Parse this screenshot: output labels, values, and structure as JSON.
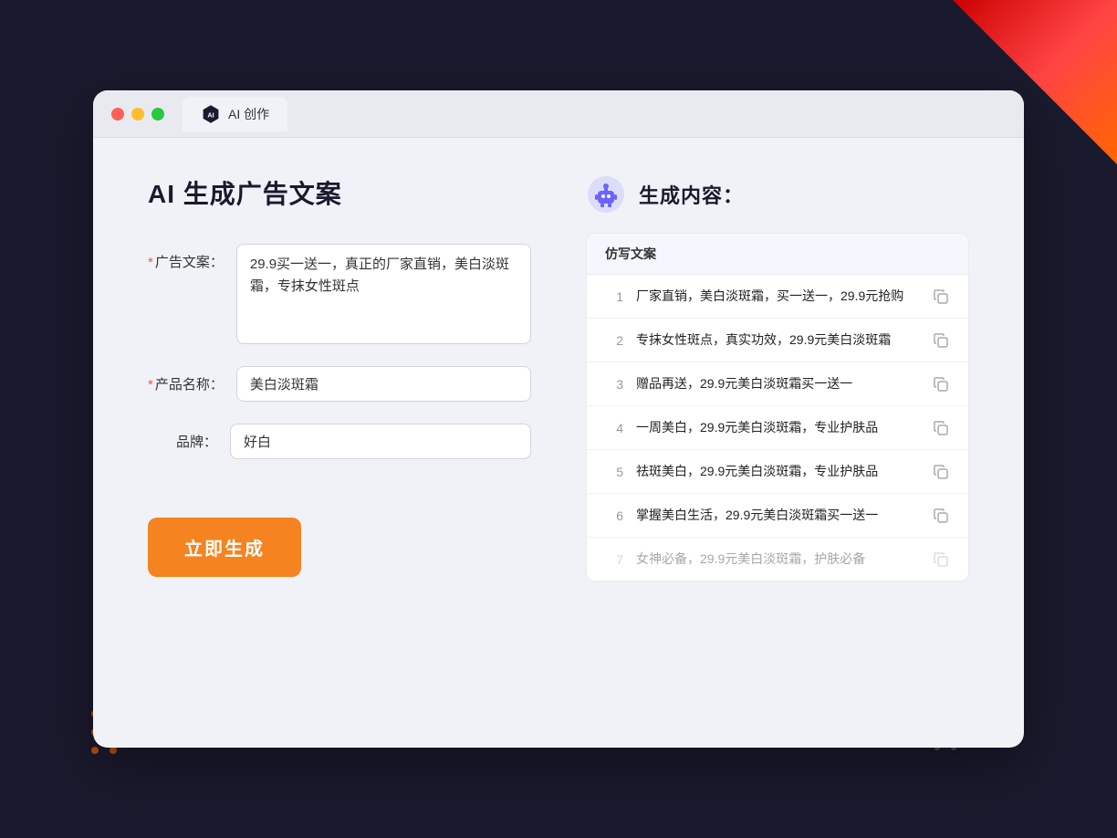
{
  "window": {
    "tab_title": "AI 创作"
  },
  "left": {
    "page_title": "AI 生成广告文案",
    "fields": [
      {
        "label": "广告文案：",
        "required": true,
        "type": "textarea",
        "value": "29.9买一送一，真正的厂家直销，美白淡斑霜，专抹女性斑点",
        "name": "ad-copy-input"
      },
      {
        "label": "产品名称：",
        "required": true,
        "type": "text",
        "value": "美白淡斑霜",
        "name": "product-name-input"
      },
      {
        "label": "品牌：",
        "required": false,
        "type": "text",
        "value": "好白",
        "name": "brand-input"
      }
    ],
    "button_label": "立即生成"
  },
  "right": {
    "title": "生成内容：",
    "column_header": "仿写文案",
    "results": [
      {
        "num": "1",
        "text": "厂家直销，美白淡斑霜，买一送一，29.9元抢购",
        "faded": false
      },
      {
        "num": "2",
        "text": "专抹女性斑点，真实功效，29.9元美白淡斑霜",
        "faded": false
      },
      {
        "num": "3",
        "text": "赠品再送，29.9元美白淡斑霜买一送一",
        "faded": false
      },
      {
        "num": "4",
        "text": "一周美白，29.9元美白淡斑霜，专业护肤品",
        "faded": false
      },
      {
        "num": "5",
        "text": "祛斑美白，29.9元美白淡斑霜，专业护肤品",
        "faded": false
      },
      {
        "num": "6",
        "text": "掌握美白生活，29.9元美白淡斑霜买一送一",
        "faded": false
      },
      {
        "num": "7",
        "text": "女神必备，29.9元美白淡斑霜，护肤必备",
        "faded": true
      }
    ]
  },
  "colors": {
    "orange_btn": "#f5831f",
    "accent_blue": "#5b7cff",
    "required_red": "#ff4d4f"
  }
}
